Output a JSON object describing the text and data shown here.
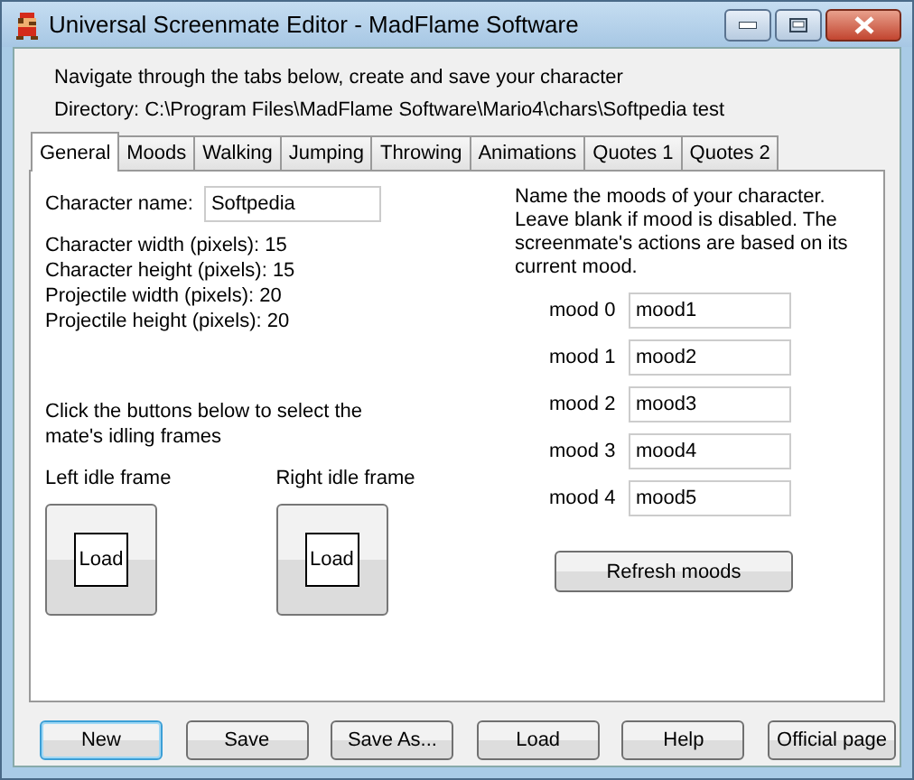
{
  "window": {
    "title": "Universal Screenmate Editor - MadFlame Software"
  },
  "intro": "Navigate through the tabs below, create and save your character",
  "directory": "Directory: C:\\Program Files\\MadFlame Software\\Mario4\\chars\\Softpedia test",
  "tabs": [
    {
      "label": "General",
      "selected": true
    },
    {
      "label": "Moods",
      "selected": false
    },
    {
      "label": "Walking",
      "selected": false
    },
    {
      "label": "Jumping",
      "selected": false
    },
    {
      "label": "Throwing",
      "selected": false
    },
    {
      "label": "Animations",
      "selected": false
    },
    {
      "label": "Quotes 1",
      "selected": false
    },
    {
      "label": "Quotes 2",
      "selected": false
    }
  ],
  "general": {
    "character_name": {
      "label": "Character name:",
      "value": "Softpedia"
    },
    "stats": [
      "Character width (pixels): 15",
      "Character height (pixels): 15",
      "Projectile width (pixels): 20",
      "Projectile height (pixels): 20"
    ],
    "idle_instruction": "Click the buttons below to select the mate's idling frames",
    "idle_frames": [
      {
        "label": "Left idle frame",
        "button": "Load"
      },
      {
        "label": "Right idle frame",
        "button": "Load"
      }
    ],
    "moods_description": "Name the moods of your character. Leave blank if mood is disabled. The screenmate's actions are based on its current mood.",
    "moods": [
      {
        "label": "mood 0",
        "value": "mood1"
      },
      {
        "label": "mood 1",
        "value": "mood2"
      },
      {
        "label": "mood 2",
        "value": "mood3"
      },
      {
        "label": "mood 3",
        "value": "mood4"
      },
      {
        "label": "mood 4",
        "value": "mood5"
      }
    ],
    "refresh_button": "Refresh moods"
  },
  "buttons": [
    {
      "label": "New",
      "focused": true
    },
    {
      "label": "Save",
      "focused": false
    },
    {
      "label": "Save As...",
      "focused": false
    },
    {
      "label": "Load",
      "focused": false
    },
    {
      "label": "Help",
      "focused": false
    },
    {
      "label": "Official page",
      "focused": false
    }
  ]
}
